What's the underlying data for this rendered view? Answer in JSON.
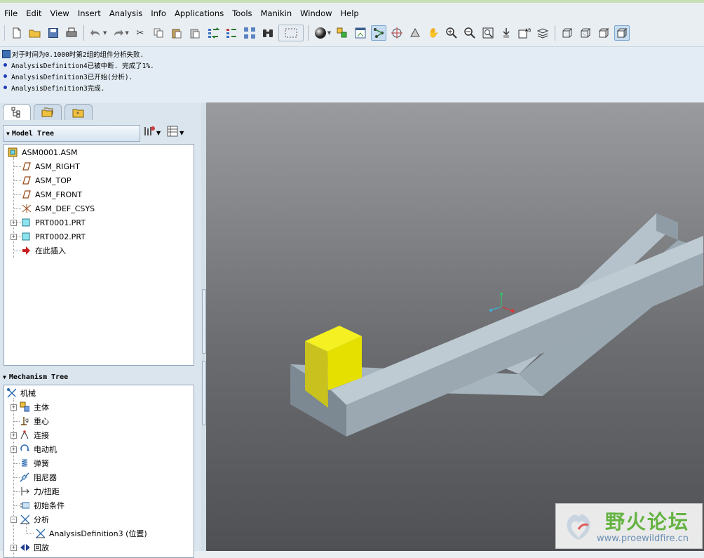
{
  "menu": [
    "File",
    "Edit",
    "View",
    "Insert",
    "Analysis",
    "Info",
    "Applications",
    "Tools",
    "Manikin",
    "Window",
    "Help"
  ],
  "toolbar_icons": [
    "new-file-icon",
    "open-folder-icon",
    "save-icon",
    "print-icon",
    "undo-icon",
    "redo-icon",
    "cut-icon",
    "copy-icon",
    "paste-icon",
    "paste-special-icon",
    "regenerate-icon",
    "regen-manager-icon",
    "find-icon",
    "binoculars-icon",
    "select-box-icon",
    "sphere-display-icon",
    "layers-icon",
    "view-manager-icon",
    "drag-components-icon",
    "spin-center-icon",
    "orient-icon",
    "pan-hand-icon",
    "zoom-in-icon",
    "zoom-out-icon",
    "refit-icon",
    "spin-icon",
    "annotation-icon",
    "layer-stack-icon",
    "wireframe-icon",
    "hidden-line-icon",
    "no-hidden-icon",
    "shading-icon"
  ],
  "messages": [
    {
      "type": "warning",
      "text": "对于时间为0.1000时第2组的组件分析失败."
    },
    {
      "type": "info",
      "text": "AnalysisDefinition4已被中断. 完成了1%."
    },
    {
      "type": "info",
      "text": "AnalysisDefinition3已开始(分析)."
    },
    {
      "type": "info",
      "text": "AnalysisDefinition3完成."
    }
  ],
  "model_tree": {
    "header": "Model Tree",
    "items": [
      {
        "label": "ASM0001.ASM",
        "icon": "assembly-icon"
      },
      {
        "label": "ASM_RIGHT",
        "icon": "datum-plane-icon"
      },
      {
        "label": "ASM_TOP",
        "icon": "datum-plane-icon"
      },
      {
        "label": "ASM_FRONT",
        "icon": "datum-plane-icon"
      },
      {
        "label": "ASM_DEF_CSYS",
        "icon": "csys-icon"
      },
      {
        "label": "PRT0001.PRT",
        "icon": "part-icon"
      },
      {
        "label": "PRT0002.PRT",
        "icon": "part-icon"
      },
      {
        "label": "在此插入",
        "icon": "insert-here-icon"
      }
    ]
  },
  "mechanism_tree": {
    "header": "Mechanism Tree",
    "items": [
      {
        "label": "机械",
        "icon": "mechanism-icon"
      },
      {
        "label": "主体",
        "icon": "body-icon"
      },
      {
        "label": "重心",
        "icon": "gravity-icon"
      },
      {
        "label": "连接",
        "icon": "connection-icon"
      },
      {
        "label": "电动机",
        "icon": "motor-icon"
      },
      {
        "label": "弹簧",
        "icon": "spring-icon"
      },
      {
        "label": "阻尼器",
        "icon": "damper-icon"
      },
      {
        "label": "力/扭距",
        "icon": "force-torque-icon"
      },
      {
        "label": "初始条件",
        "icon": "initial-condition-icon"
      },
      {
        "label": "分析",
        "icon": "analysis-icon"
      },
      {
        "label": "AnalysisDefinition3 (位置)",
        "icon": "analysis-definition-icon"
      },
      {
        "label": "回放",
        "icon": "playback-icon"
      }
    ]
  },
  "watermark": {
    "title": "野火论坛",
    "url": "www.proewildfire.cn"
  },
  "colors": {
    "viewport_top": "#999b9e",
    "viewport_bottom": "#4e5053",
    "rail": "#a9b9c4",
    "slider": "#e8e000"
  }
}
